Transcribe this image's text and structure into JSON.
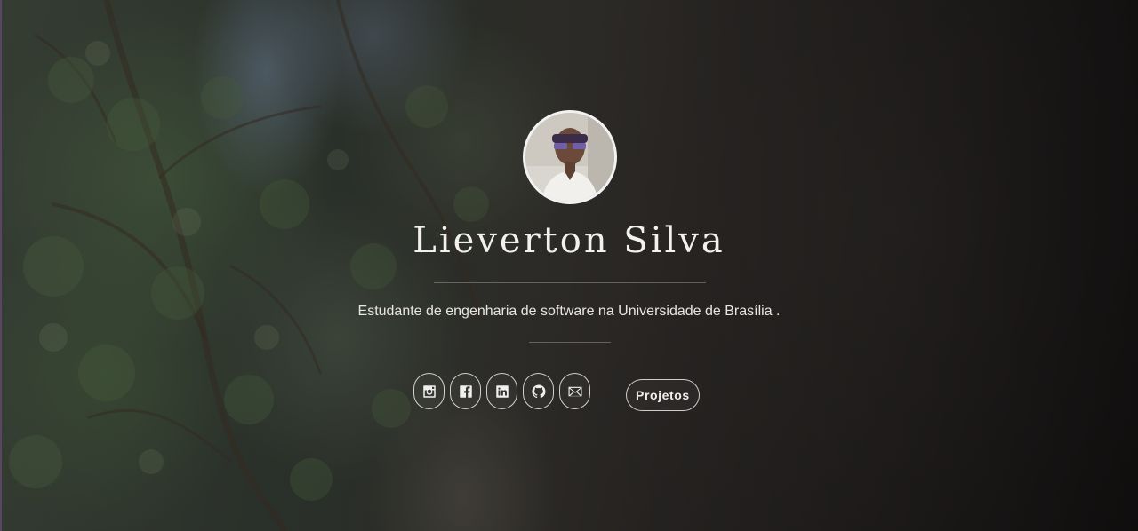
{
  "profile": {
    "name": "Lieverton Silva",
    "tagline": "Estudante de engenharia de software na Universidade de Brasília ."
  },
  "social_links": [
    {
      "icon": "instagram-icon"
    },
    {
      "icon": "facebook-icon"
    },
    {
      "icon": "linkedin-icon"
    },
    {
      "icon": "github-icon"
    },
    {
      "icon": "email-icon"
    }
  ],
  "actions": {
    "projects_label": "Projetos"
  },
  "colors": {
    "text": "#f3f1ee",
    "border": "#ebebeb",
    "accent_edge": "#6b4a78"
  }
}
